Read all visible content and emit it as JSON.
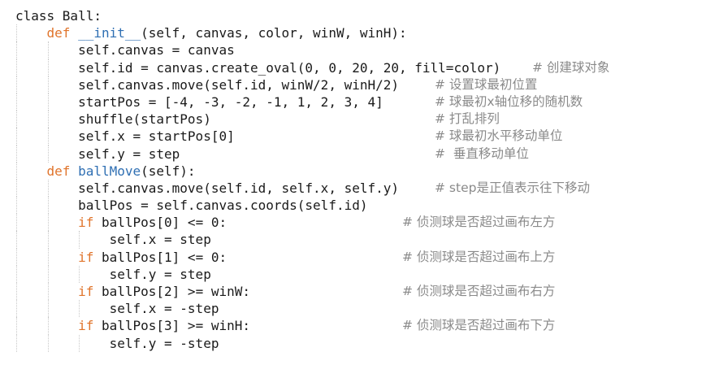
{
  "lines": [
    {
      "parts": [
        {
          "t": "class Ball:",
          "c": ""
        }
      ]
    },
    {
      "indent": "    ",
      "parts": [
        {
          "t": "def ",
          "c": "kw"
        },
        {
          "t": "__init__",
          "c": "fn"
        },
        {
          "t": "(self, canvas, color, winW, winH):",
          "c": ""
        }
      ]
    },
    {
      "indent": "        ",
      "parts": [
        {
          "t": "self.canvas = canvas",
          "c": ""
        }
      ]
    },
    {
      "indent": "        ",
      "parts": [
        {
          "t": "self.id = canvas.create_oval(0, 0, 20, 20, fill=color)",
          "c": ""
        }
      ],
      "comment": "# 创建球对象"
    },
    {
      "indent": "        ",
      "parts": [
        {
          "t": "self.canvas.move(self.id, winW/2, winH/2)",
          "c": ""
        }
      ],
      "comment": "# 设置球最初位置"
    },
    {
      "indent": "        ",
      "parts": [
        {
          "t": "startPos = [-4, -3, -2, -1, 1, 2, 3, 4]",
          "c": ""
        }
      ],
      "comment": "# 球最初x轴位移的随机数"
    },
    {
      "indent": "        ",
      "parts": [
        {
          "t": "shuffle(startPos)",
          "c": ""
        }
      ],
      "comment": "# 打乱排列"
    },
    {
      "indent": "        ",
      "parts": [
        {
          "t": "self.x = startPos[0]",
          "c": ""
        }
      ],
      "comment": "# 球最初水平移动单位"
    },
    {
      "indent": "        ",
      "parts": [
        {
          "t": "self.y = step",
          "c": ""
        }
      ],
      "comment": "#  垂直移动单位"
    },
    {
      "indent": "    ",
      "parts": [
        {
          "t": "def ",
          "c": "kw"
        },
        {
          "t": "ballMove",
          "c": "fn"
        },
        {
          "t": "(self):",
          "c": ""
        }
      ]
    },
    {
      "indent": "        ",
      "parts": [
        {
          "t": "self.canvas.move(self.id, self.x, self.y)",
          "c": ""
        }
      ],
      "comment": "# step是正值表示往下移动"
    },
    {
      "indent": "        ",
      "parts": [
        {
          "t": "ballPos = self.canvas.coords(self.id)",
          "c": ""
        }
      ]
    },
    {
      "indent": "        ",
      "parts": [
        {
          "t": "if ",
          "c": "kw"
        },
        {
          "t": "ballPos[0] <= 0:",
          "c": ""
        }
      ],
      "comment": "# 侦测球是否超过画布左方"
    },
    {
      "indent": "            ",
      "parts": [
        {
          "t": "self.x = step",
          "c": ""
        }
      ]
    },
    {
      "indent": "        ",
      "parts": [
        {
          "t": "if ",
          "c": "kw"
        },
        {
          "t": "ballPos[1] <= 0:",
          "c": ""
        }
      ],
      "comment": "# 侦测球是否超过画布上方"
    },
    {
      "indent": "            ",
      "parts": [
        {
          "t": "self.y = step",
          "c": ""
        }
      ]
    },
    {
      "indent": "        ",
      "parts": [
        {
          "t": "if ",
          "c": "kw"
        },
        {
          "t": "ballPos[2] >= winW:",
          "c": ""
        }
      ],
      "comment": "# 侦测球是否超过画布右方"
    },
    {
      "indent": "            ",
      "parts": [
        {
          "t": "self.x = -step",
          "c": ""
        }
      ]
    },
    {
      "indent": "        ",
      "parts": [
        {
          "t": "if ",
          "c": "kw"
        },
        {
          "t": "ballPos[3] >= winH:",
          "c": ""
        }
      ],
      "comment": "# 侦测球是否超过画布下方"
    },
    {
      "indent": "            ",
      "parts": [
        {
          "t": "self.y = -step",
          "c": ""
        }
      ]
    }
  ]
}
